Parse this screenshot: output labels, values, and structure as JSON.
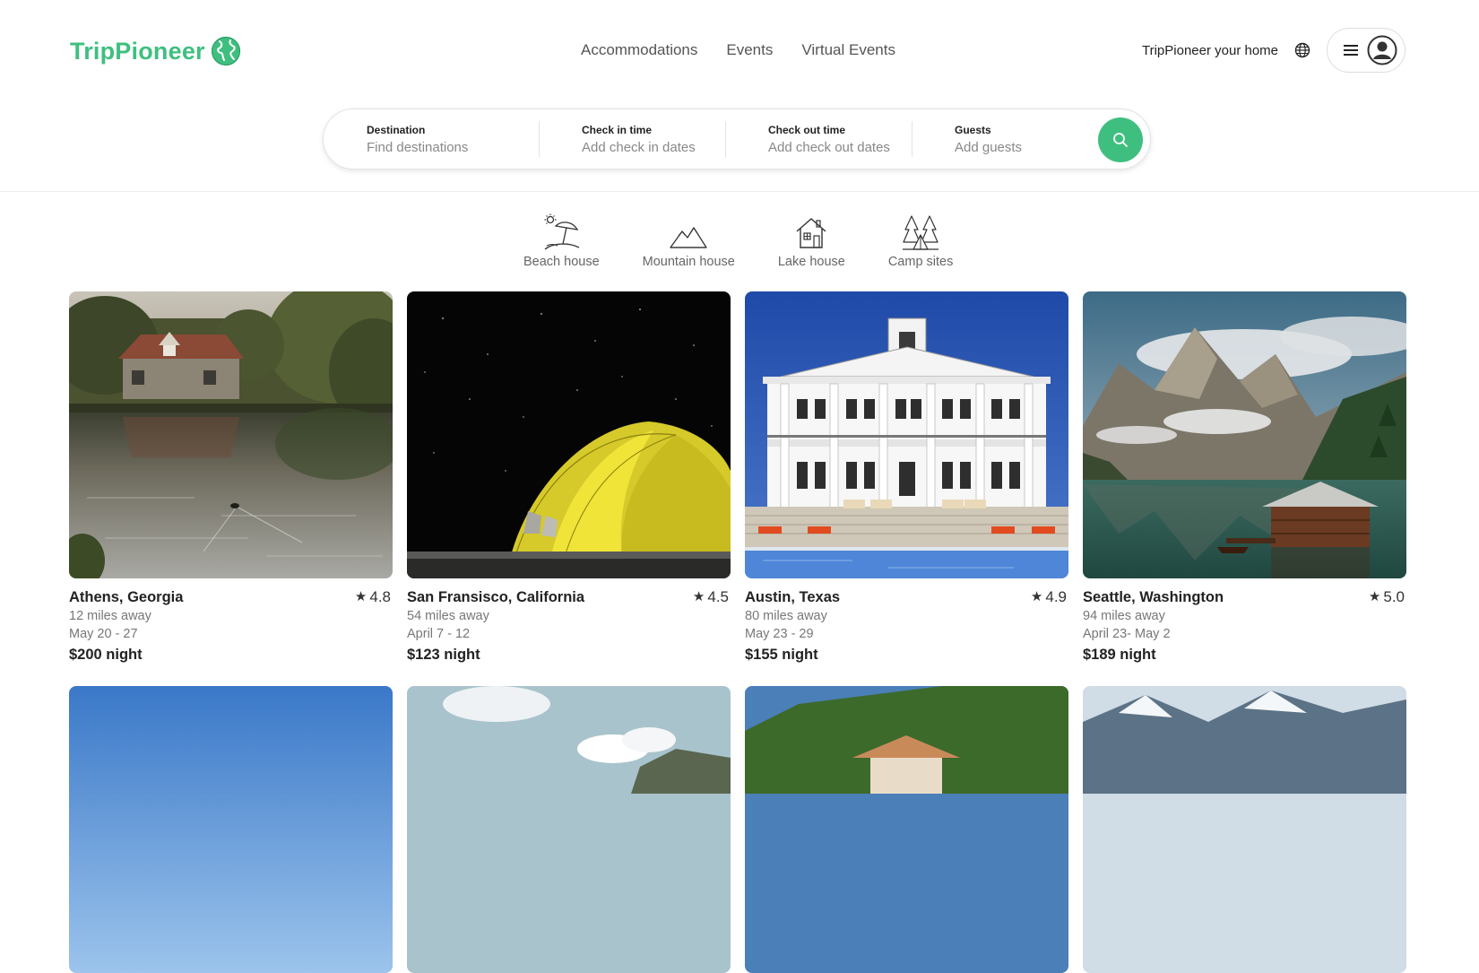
{
  "header": {
    "logo_text": "TripPioneer",
    "nav": [
      "Accommodations",
      "Events",
      "Virtual Events"
    ],
    "host_link": "TripPioneer your home"
  },
  "search": {
    "fields": [
      {
        "label": "Destination",
        "placeholder": "Find destinations"
      },
      {
        "label": "Check in time",
        "placeholder": "Add check in dates"
      },
      {
        "label": "Check out time",
        "placeholder": "Add check out dates"
      },
      {
        "label": "Guests",
        "placeholder": "Add guests"
      }
    ]
  },
  "categories": [
    {
      "label": "Beach house",
      "icon": "beach-house-icon"
    },
    {
      "label": "Mountain house",
      "icon": "mountain-house-icon"
    },
    {
      "label": "Lake house",
      "icon": "lake-house-icon"
    },
    {
      "label": "Camp sites",
      "icon": "camp-sites-icon"
    }
  ],
  "listings": [
    {
      "location": "Athens, Georgia",
      "rating": "4.8",
      "distance": "12 miles away",
      "dates": "May 20 - 27",
      "price": "$200 night"
    },
    {
      "location": "San Fransisco, California",
      "rating": "4.5",
      "distance": "54 miles away",
      "dates": "April 7 - 12",
      "price": "$123 night"
    },
    {
      "location": "Austin, Texas",
      "rating": "4.9",
      "distance": "80 miles away",
      "dates": "May 23 - 29",
      "price": "$155 night"
    },
    {
      "location": "Seattle, Washington",
      "rating": "5.0",
      "distance": "94 miles away",
      "dates": "April 23- May 2",
      "price": "$189 night"
    }
  ],
  "colors": {
    "brand": "#3fbf7f",
    "text": "#222222",
    "muted": "#777777"
  }
}
